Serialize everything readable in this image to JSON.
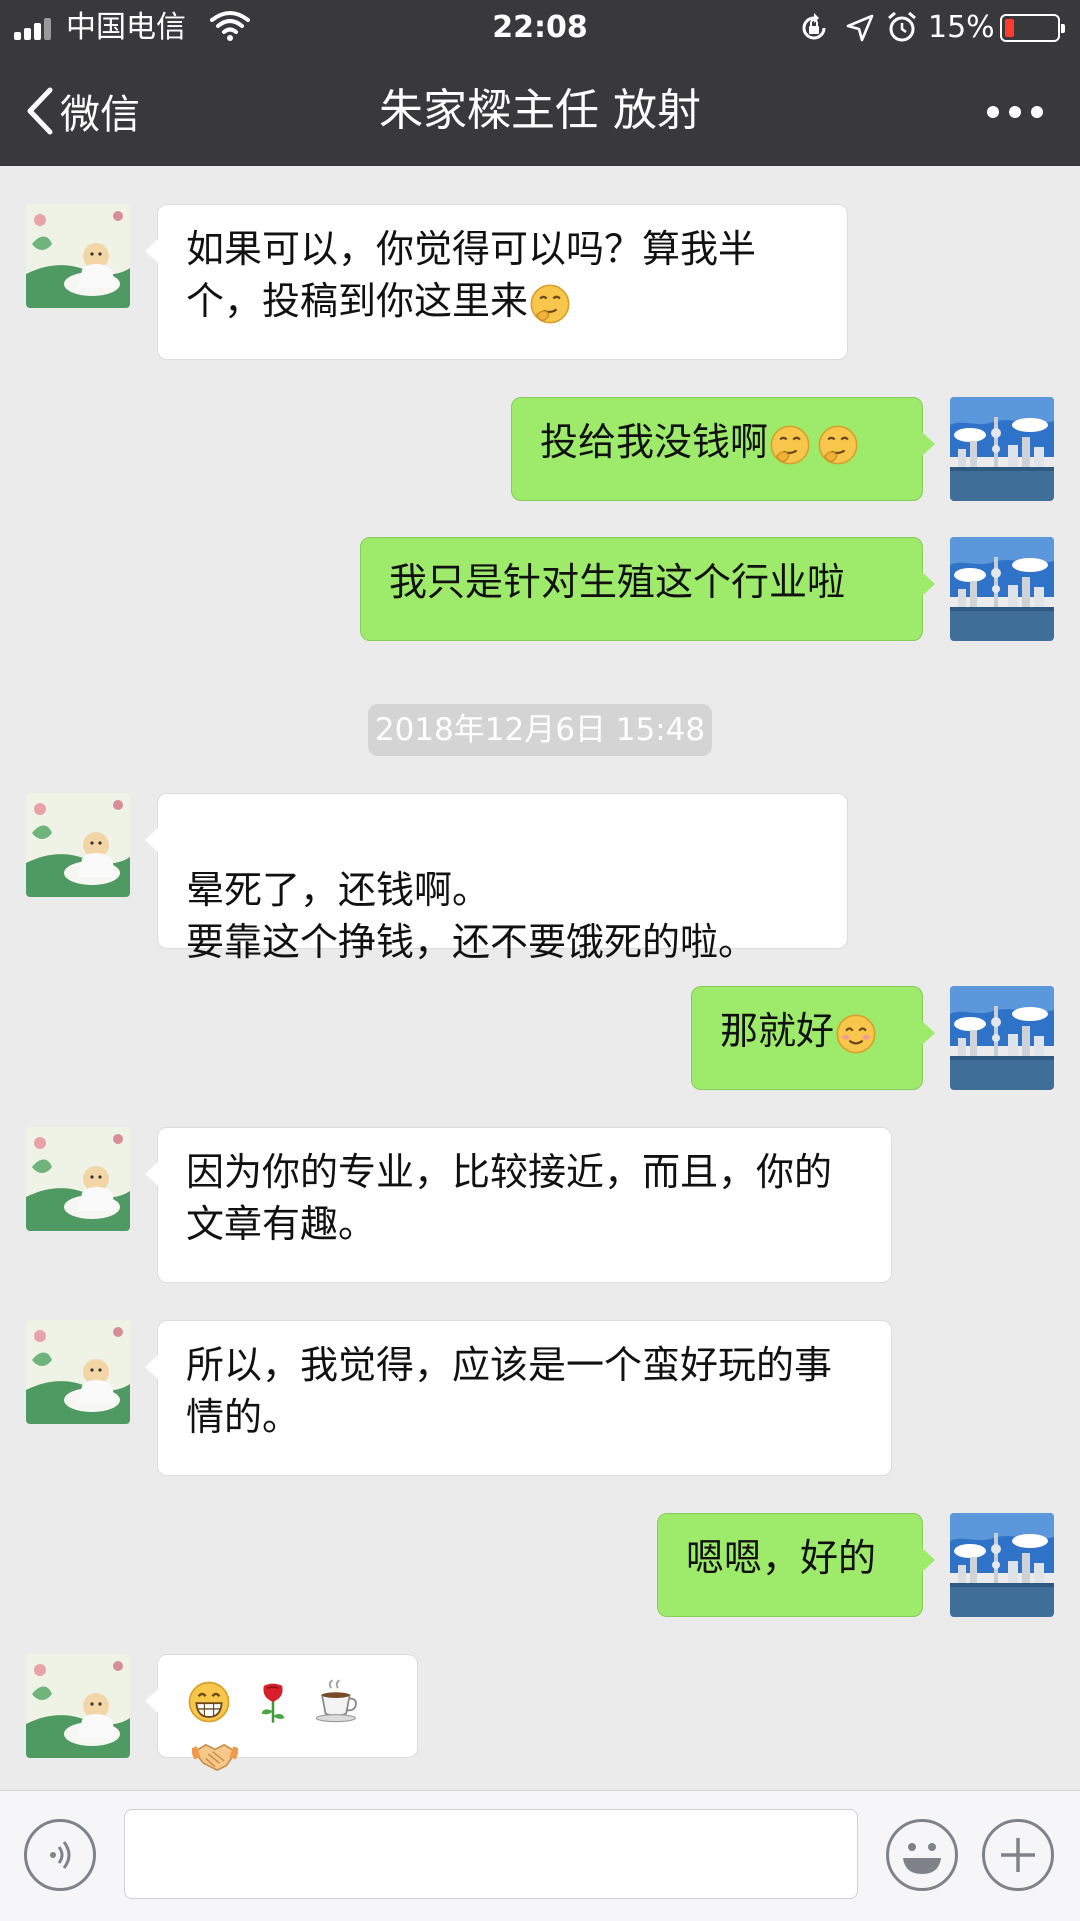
{
  "status_bar": {
    "carrier": "中国电信",
    "time": "22:08",
    "battery_percent": "15%",
    "battery_level": 0.15,
    "icons": [
      "signal-icon",
      "wifi-icon",
      "orientation-lock-icon",
      "location-icon",
      "alarm-icon",
      "battery-icon"
    ]
  },
  "nav": {
    "back_label": "微信",
    "title": "朱家樑主任 放射",
    "more_icon": "more-icon"
  },
  "colors": {
    "bar_bg": "#39393b",
    "chat_bg": "#ebebeb",
    "sent_bubble": "#9eea6a",
    "received_bubble": "#ffffff"
  },
  "messages": [
    {
      "side": "left",
      "text": "如果可以，你觉得可以吗？算我半个，投稿到你这里来",
      "emojis": [
        "thinking-emoji"
      ]
    },
    {
      "side": "right",
      "text": "投给我没钱啊",
      "emojis": [
        "thinking-emoji",
        "thinking-emoji"
      ]
    },
    {
      "side": "right",
      "text": "我只是针对生殖这个行业啦",
      "emojis": []
    },
    {
      "side": "left",
      "text": "晕死了，还钱啊。\n要靠这个挣钱，还不要饿死的啦。",
      "emojis": []
    },
    {
      "side": "right",
      "text": "那就好",
      "emojis": [
        "smile-emoji"
      ]
    },
    {
      "side": "left",
      "text": "因为你的专业，比较接近，而且，你的文章有趣。",
      "emojis": []
    },
    {
      "side": "left",
      "text": "所以，我觉得，应该是一个蛮好玩的事情的。",
      "emojis": []
    },
    {
      "side": "right",
      "text": "嗯嗯，好的",
      "emojis": []
    },
    {
      "side": "left",
      "text": "",
      "emojis": [
        "grin-emoji",
        "rose-emoji",
        "coffee-emoji",
        "handshake-emoji"
      ]
    }
  ],
  "timestamp": "2018年12月6日 15:48",
  "input_bar": {
    "voice_icon": "voice-icon",
    "input_value": "",
    "emoji_icon": "emoji-icon",
    "add_icon": "add-icon"
  }
}
